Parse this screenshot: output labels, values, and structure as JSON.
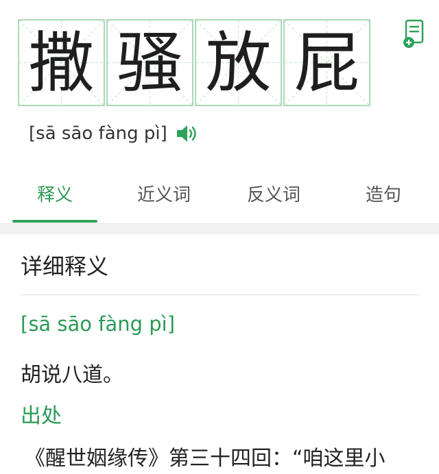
{
  "word": {
    "chars": [
      "撒",
      "骚",
      "放",
      "屁"
    ],
    "pinyin": "[sā sāo fàng pì]"
  },
  "icons": {
    "save": "add-to-notebook-icon",
    "speaker": "speaker-icon"
  },
  "tabs": [
    {
      "label": "释义",
      "active": true
    },
    {
      "label": "近义词",
      "active": false
    },
    {
      "label": "反义词",
      "active": false
    },
    {
      "label": "造句",
      "active": false
    }
  ],
  "detail": {
    "title": "详细释义",
    "pinyin": "[sā sāo fàng pì]",
    "definition": "胡说八道。",
    "source_label": "出处",
    "source_text": "《醒世姻缘传》第三十四回：“咱这里小"
  },
  "colors": {
    "accent": "#2ea25a",
    "grid": "#a9d9b5"
  }
}
